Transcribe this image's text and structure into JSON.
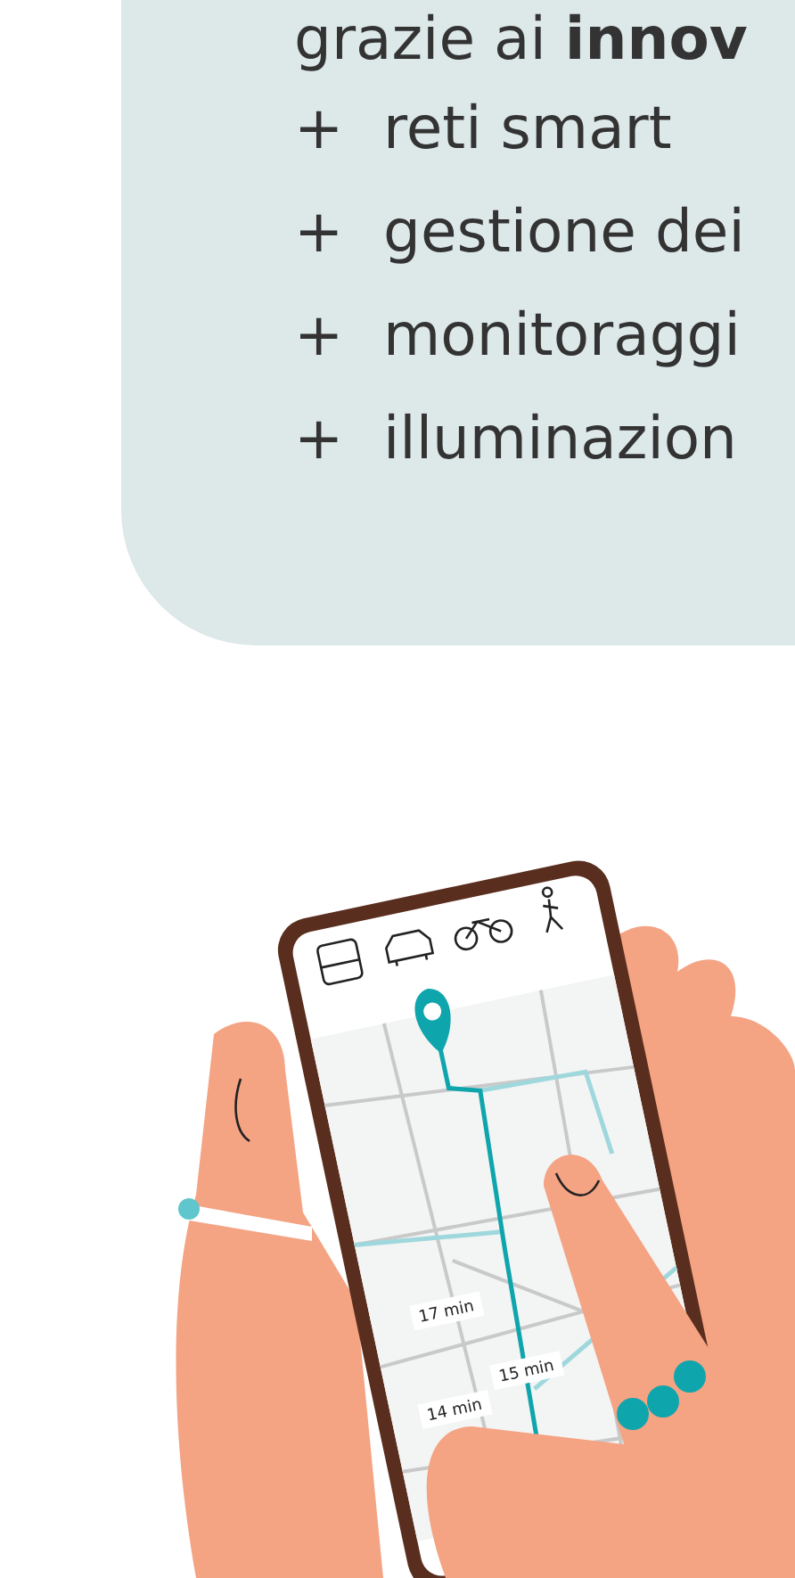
{
  "panel": {
    "heading": "grazie ai **innov**",
    "items": [
      "reti smart",
      "gestione dei",
      "monitoraggi",
      "illuminazion"
    ],
    "bullet": "+"
  },
  "illustration": {
    "route_times": [
      "17 min",
      "14 min",
      "15 min"
    ]
  }
}
